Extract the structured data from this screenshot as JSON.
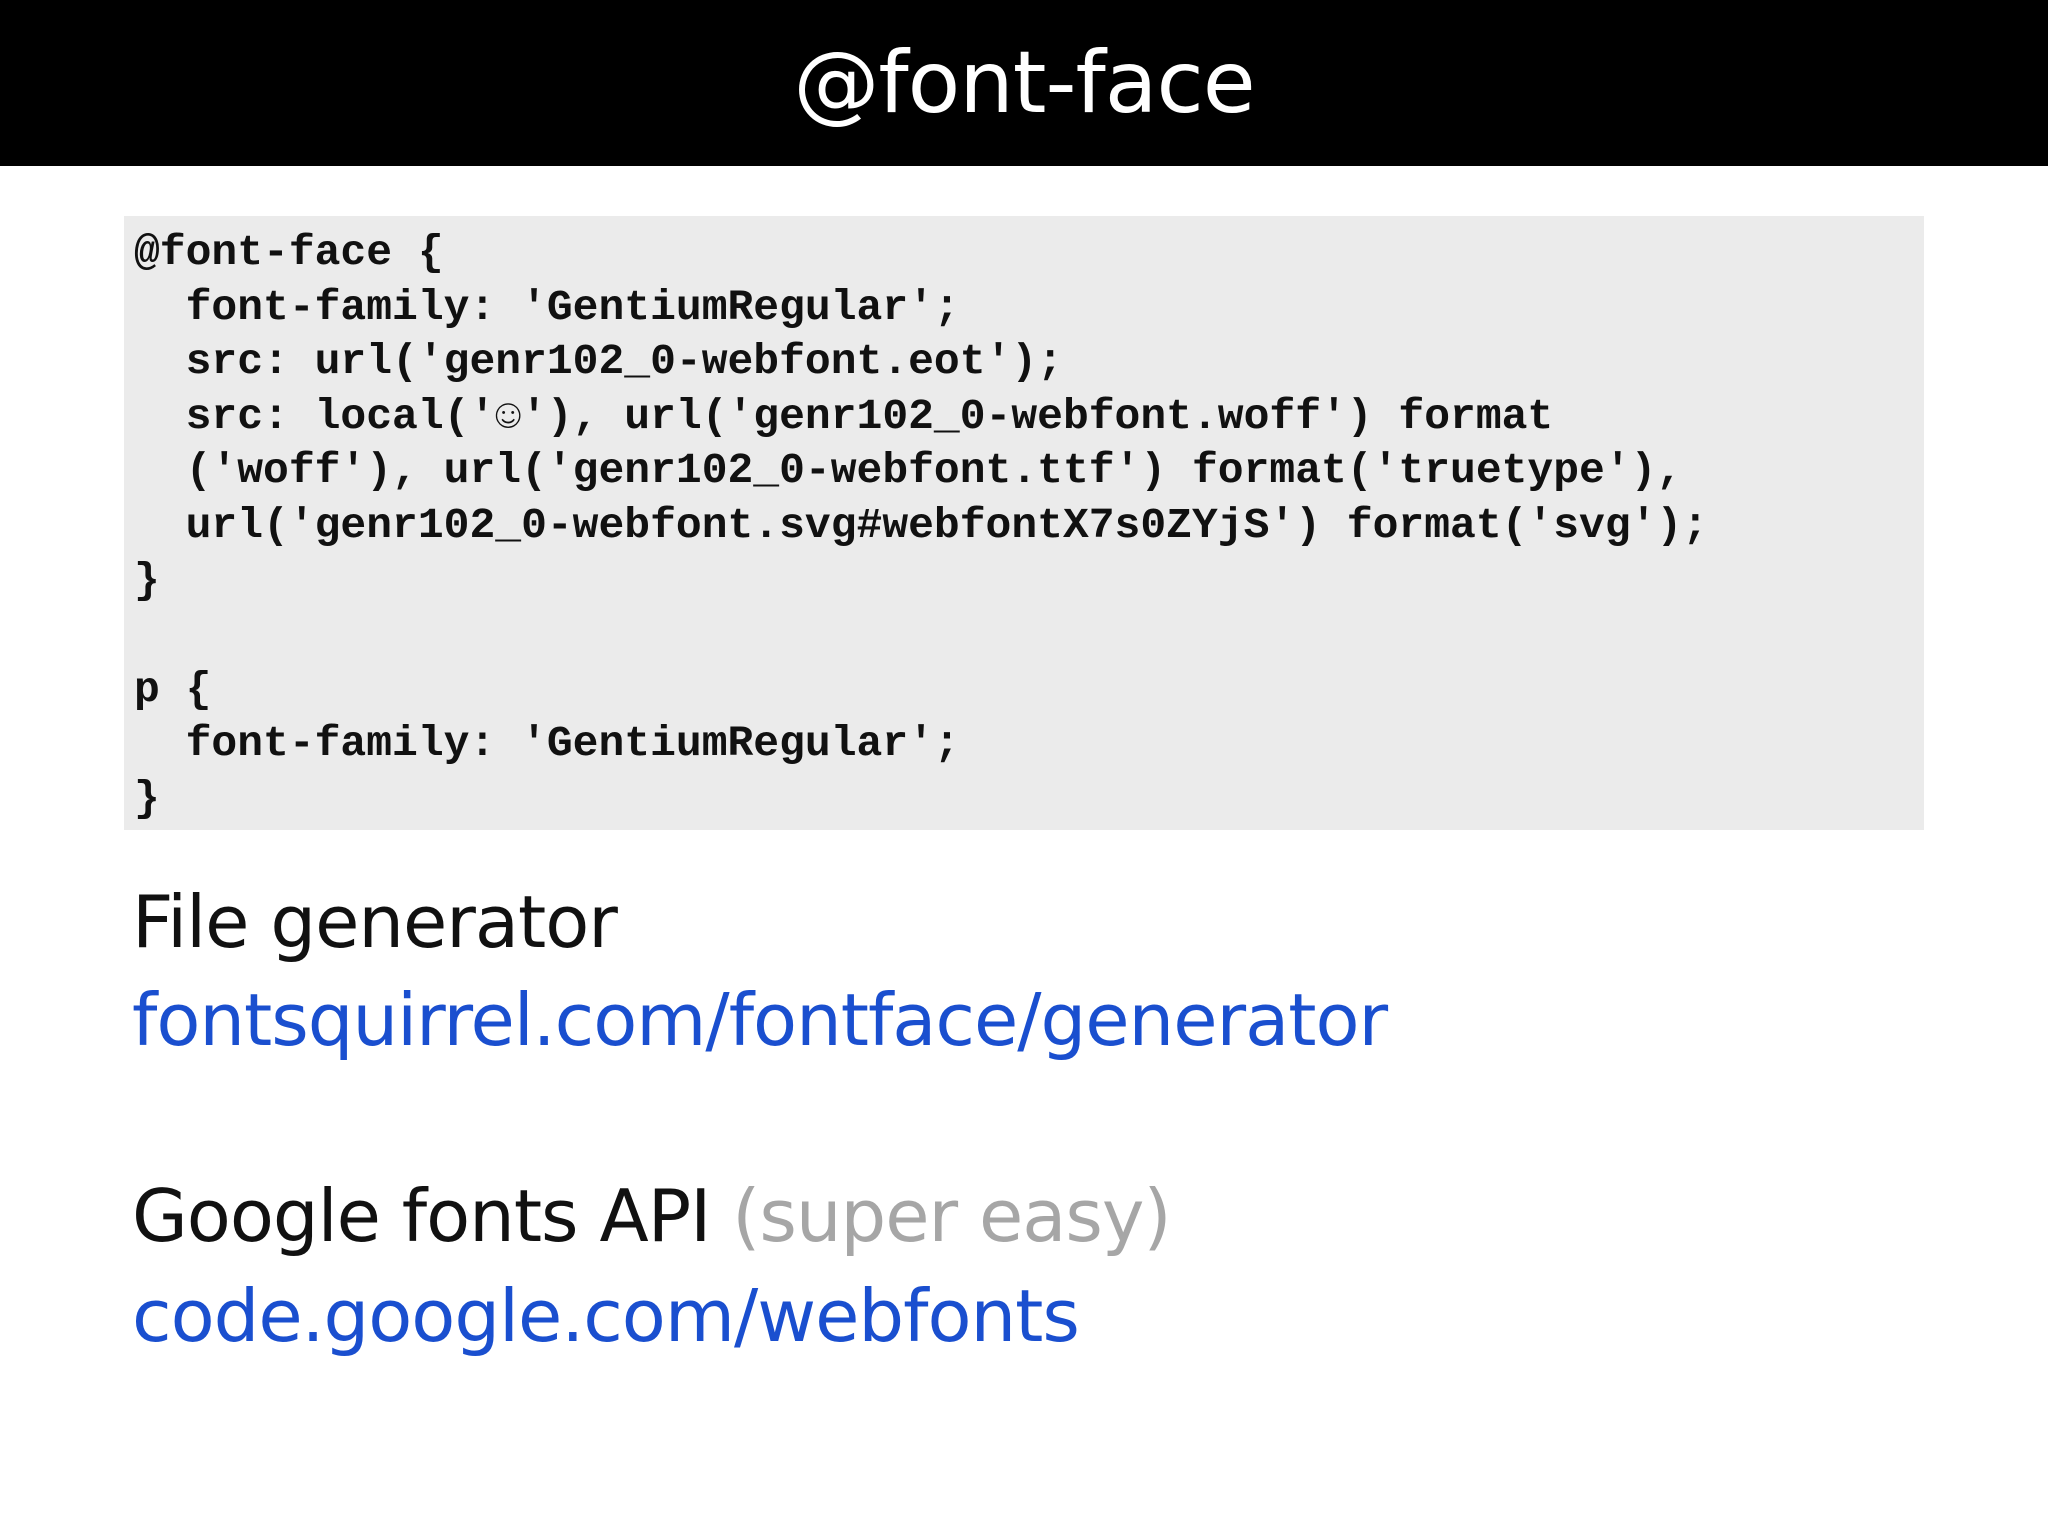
{
  "slide": {
    "title": "@font-face"
  },
  "code_block": {
    "lines": [
      "@font-face {",
      "  font-family: 'GentiumRegular';",
      "  src: url('genr102_0-webfont.eot');",
      "  src: local('☺'), url('genr102_0-webfont.woff') format",
      "  ('woff'), url('genr102_0-webfont.ttf') format('truetype'),",
      "  url('genr102_0-webfont.svg#webfontX7s0ZYjS') format('svg');",
      "}",
      "",
      "p {",
      "  font-family: 'GentiumRegular';",
      "}"
    ]
  },
  "sections": {
    "file_generator": {
      "heading": "File generator",
      "link": "fontsquirrel.com/fontface/generator"
    },
    "google_fonts": {
      "heading": "Google fonts API",
      "aside": "(super easy)",
      "link": "code.google.com/webfonts"
    }
  },
  "colors": {
    "title_bar": "#000000",
    "title_text": "#ffffff",
    "code_background": "#ebebeb",
    "link": "#1a4fcf",
    "aside": "#a6a6a6"
  }
}
